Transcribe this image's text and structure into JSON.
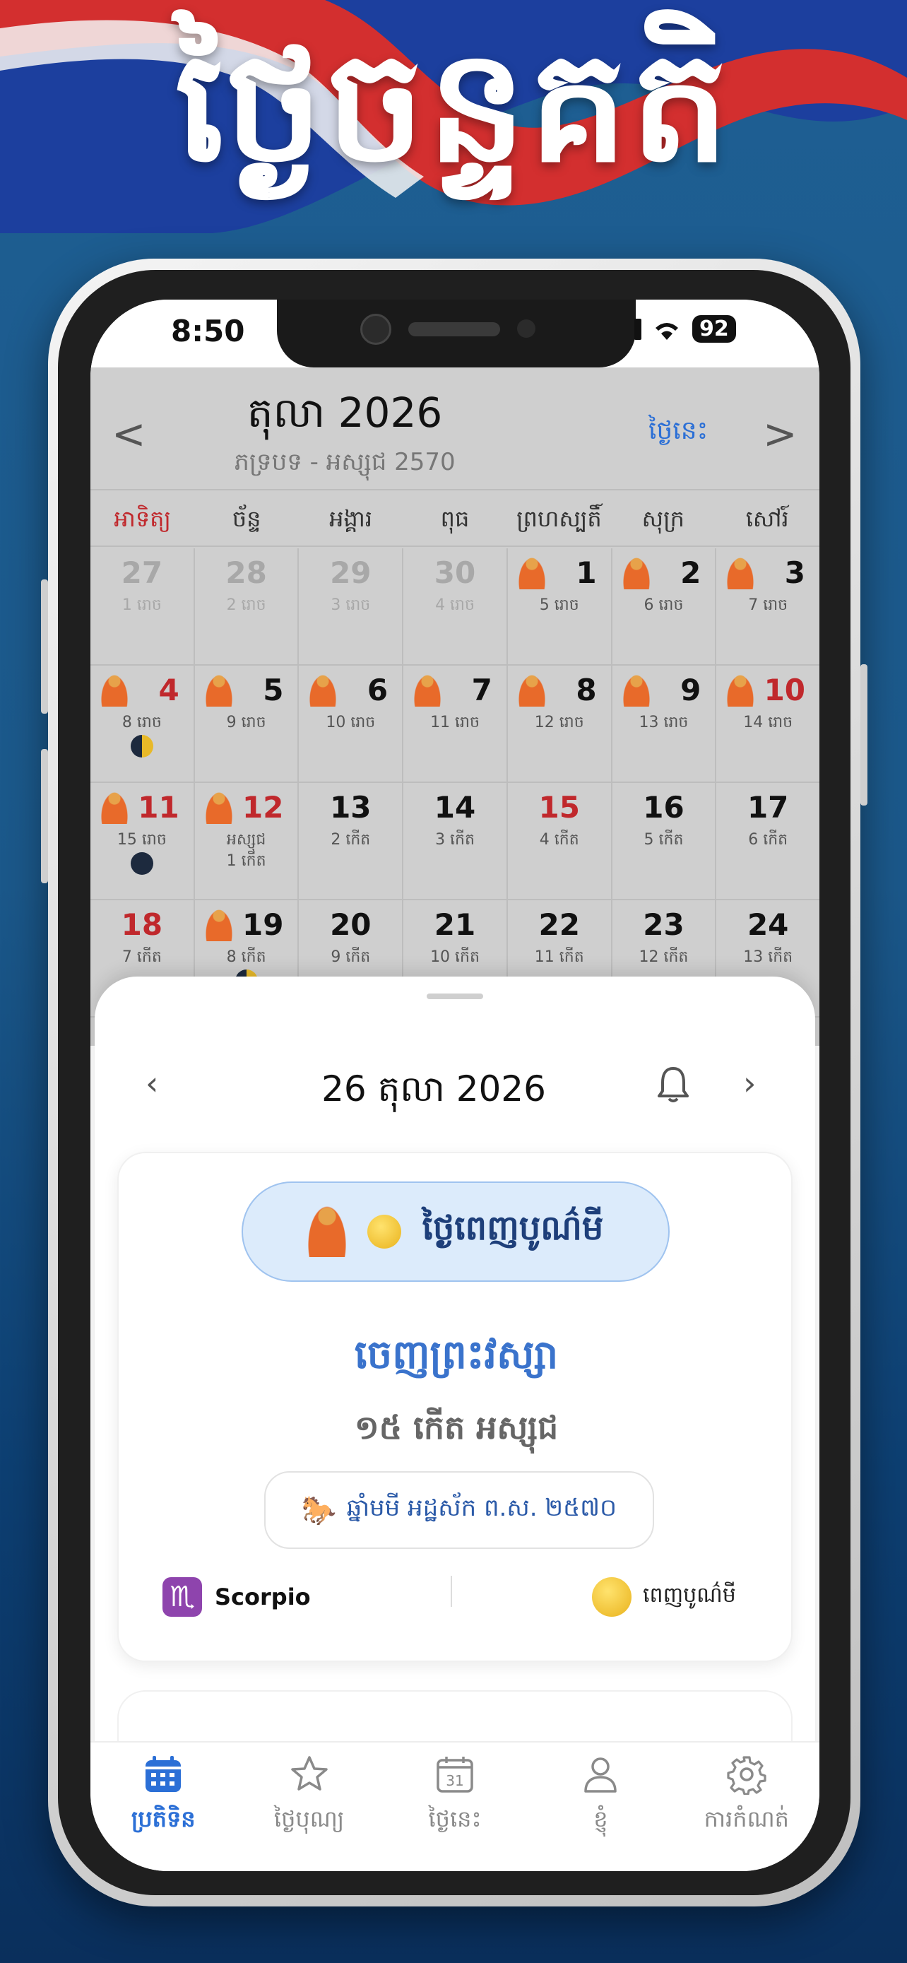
{
  "app_title": "ថ្ងៃចន្ទគតិ",
  "status_bar": {
    "time": "8:50",
    "battery": "92"
  },
  "calendar": {
    "month_title": "តុលា 2026",
    "subtitle": "ភទ្របទ - អស្សុជ 2570",
    "today_label": "ថ្ងៃនេះ",
    "prev": "<",
    "next": ">",
    "weekdays": [
      "អាទិត្យ",
      "ច័ន្ទ",
      "អង្គារ",
      "ពុធ",
      "ព្រហស្បតិ៍",
      "សុក្រ",
      "សៅរ៍"
    ],
    "weeks": [
      [
        {
          "day": "27",
          "lunar": "1 រោច",
          "muted": true
        },
        {
          "day": "28",
          "lunar": "2 រោច",
          "muted": true
        },
        {
          "day": "29",
          "lunar": "3 រោច",
          "muted": true
        },
        {
          "day": "30",
          "lunar": "4 រោច",
          "muted": true
        },
        {
          "day": "1",
          "lunar": "5 រោច",
          "buddha": true
        },
        {
          "day": "2",
          "lunar": "6 រោច",
          "buddha": true
        },
        {
          "day": "3",
          "lunar": "7 រោច",
          "buddha": true
        }
      ],
      [
        {
          "day": "4",
          "lunar": "8 រោច",
          "buddha": true,
          "holiday": true,
          "moon": "half"
        },
        {
          "day": "5",
          "lunar": "9 រោច",
          "buddha": true
        },
        {
          "day": "6",
          "lunar": "10 រោច",
          "buddha": true
        },
        {
          "day": "7",
          "lunar": "11 រោច",
          "buddha": true
        },
        {
          "day": "8",
          "lunar": "12 រោច",
          "buddha": true
        },
        {
          "day": "9",
          "lunar": "13 រោច",
          "buddha": true
        },
        {
          "day": "10",
          "lunar": "14 រោច",
          "buddha": true,
          "holiday": true
        }
      ],
      [
        {
          "day": "11",
          "lunar": "15 រោច",
          "buddha": true,
          "holiday": true,
          "moon": "dark"
        },
        {
          "day": "12",
          "lunar": "អស្សុជ",
          "lunar2": "1 កើត",
          "buddha": true,
          "holiday": true
        },
        {
          "day": "13",
          "lunar": "2 កើត"
        },
        {
          "day": "14",
          "lunar": "3 កើត"
        },
        {
          "day": "15",
          "lunar": "4 កើត",
          "holiday": true
        },
        {
          "day": "16",
          "lunar": "5 កើត"
        },
        {
          "day": "17",
          "lunar": "6 កើត"
        }
      ],
      [
        {
          "day": "18",
          "lunar": "7 កើត",
          "holiday": true
        },
        {
          "day": "19",
          "lunar": "8 កើត",
          "buddha": true,
          "moon": "half"
        },
        {
          "day": "20",
          "lunar": "9 កើត"
        },
        {
          "day": "21",
          "lunar": "10 កើត"
        },
        {
          "day": "22",
          "lunar": "11 កើត"
        },
        {
          "day": "23",
          "lunar": "12 កើត"
        },
        {
          "day": "24",
          "lunar": "13 កើត"
        }
      ]
    ]
  },
  "sheet": {
    "date": "26 តុលា 2026",
    "prev": "‹",
    "next": "›",
    "pill_text": "ថ្ងៃពេញបូណ៌មី",
    "event_title": "ចេញព្រះវស្សា",
    "lunar_date": "១៥ កើត អស្សុជ",
    "year_text": "ឆ្នាំមមី អដ្ឋស័ក ព.ស. ២៥៧០",
    "zodiac_symbol": "♏",
    "zodiac": "Scorpio",
    "moon_phase": "ពេញបូណ៌មី"
  },
  "tabs": [
    {
      "label": "ប្រតិទិន",
      "icon": "calendar-icon",
      "active": true
    },
    {
      "label": "ថ្ងៃបុណ្យ",
      "icon": "star-icon",
      "active": false
    },
    {
      "label": "ថ្ងៃនេះ",
      "icon": "calendar-31-icon",
      "active": false
    },
    {
      "label": "ខ្ញុំ",
      "icon": "person-icon",
      "active": false
    },
    {
      "label": "ការកំណត់",
      "icon": "gear-icon",
      "active": false
    }
  ],
  "colors": {
    "accent": "#2b6fd6",
    "holiday": "#c0282c",
    "flag_red": "#d32f2f",
    "flag_blue": "#1c3f9e"
  }
}
